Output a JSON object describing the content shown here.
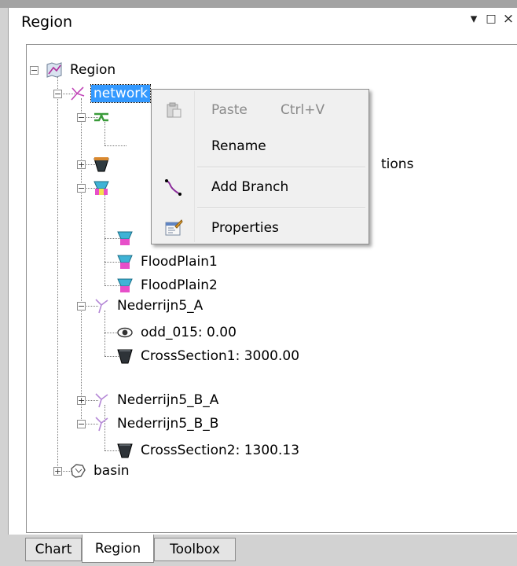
{
  "panel": {
    "title": "Region",
    "pin_glyph": "▾",
    "restore_glyph": "□",
    "close_glyph": "×"
  },
  "tree": {
    "root_label": "Region",
    "network_label": "netw",
    "network_label_tail": "ork",
    "occluded_tail": "tions",
    "floodplain1": "FloodPlain1",
    "floodplain2": "FloodPlain2",
    "nederrijn5_a": "Nederrijn5_A",
    "odd_015": "odd_015: 0.00",
    "crosssection1": "CrossSection1: 3000.00",
    "nederrijn5_b_a": "Nederrijn5_B_A",
    "nederrijn5_b_b": "Nederrijn5_B_B",
    "crosssection2": "CrossSection2: 1300.13",
    "basin": "basin"
  },
  "context_menu": {
    "paste": "Paste",
    "paste_shortcut": "Ctrl+V",
    "rename": "Rename",
    "add_branch": "Add Branch",
    "properties": "Properties"
  },
  "tabs": {
    "chart": "Chart",
    "region": "Region",
    "toolbox": "Toolbox"
  }
}
